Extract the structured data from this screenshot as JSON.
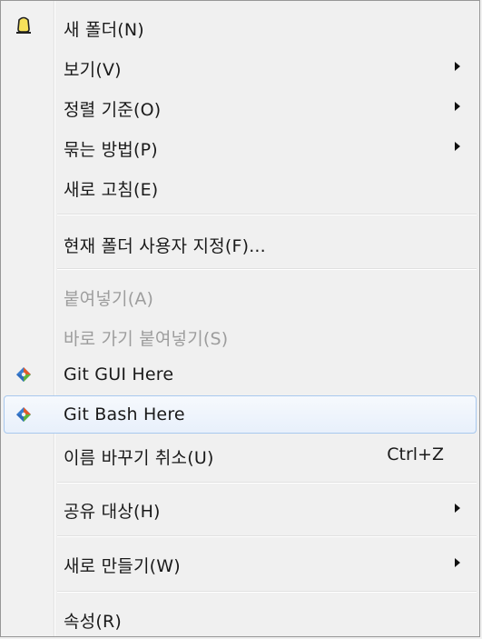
{
  "menu": {
    "items": [
      {
        "label": "새 폴더(N)",
        "icon": "new-folder-icon"
      },
      {
        "label": "보기(V)",
        "submenu": true
      },
      {
        "label": "정렬 기준(O)",
        "submenu": true
      },
      {
        "label": "묶는 방법(P)",
        "submenu": true
      },
      {
        "label": "새로 고침(E)"
      },
      {
        "label": "현재 폴더 사용자 지정(F)..."
      },
      {
        "label": "붙여넣기(A)",
        "disabled": true
      },
      {
        "label": "바로 가기 붙여넣기(S)",
        "disabled": true
      },
      {
        "label": "Git GUI Here",
        "icon": "git-icon"
      },
      {
        "label": "Git Bash Here",
        "icon": "git-icon",
        "highlighted": true
      },
      {
        "label": "이름 바꾸기 취소(U)",
        "shortcut": "Ctrl+Z"
      },
      {
        "label": "공유 대상(H)",
        "submenu": true
      },
      {
        "label": "새로 만들기(W)",
        "submenu": true
      },
      {
        "label": "속성(R)"
      }
    ]
  },
  "colors": {
    "background": "#f0f0f0",
    "highlight_border": "#a8c8ee",
    "disabled_text": "#9d9d9d"
  }
}
